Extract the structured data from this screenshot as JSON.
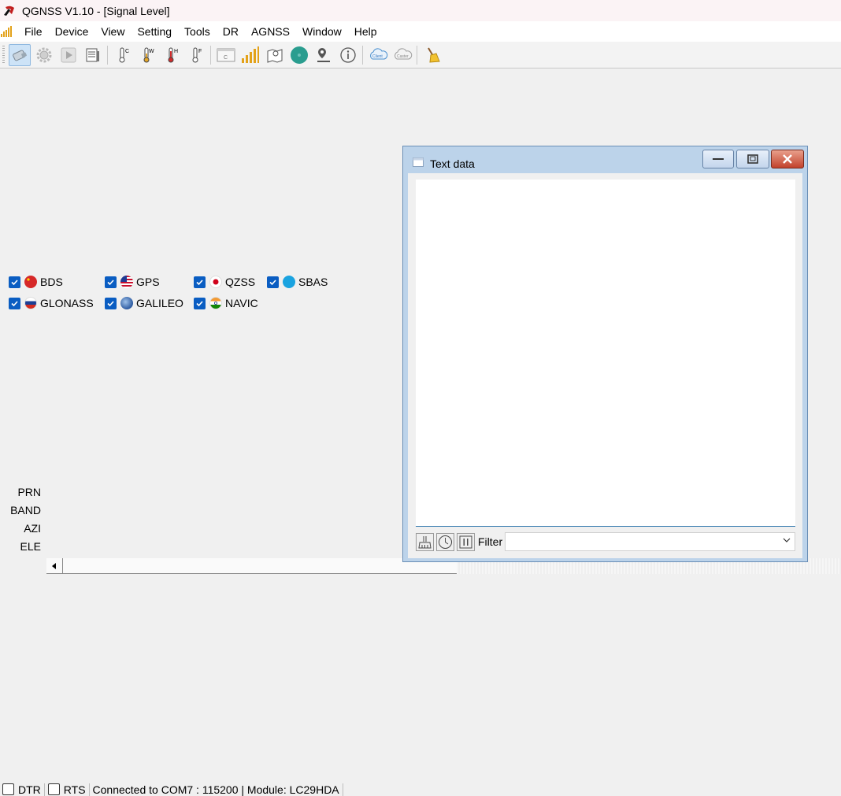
{
  "window": {
    "title": "QGNSS V1.10 - [Signal Level]"
  },
  "menu": [
    "File",
    "Device",
    "View",
    "Setting",
    "Tools",
    "DR",
    "AGNSS",
    "Window",
    "Help"
  ],
  "toolbar": {
    "icons": [
      "connect-icon",
      "settings-gear-icon",
      "play-icon",
      "log-file-icon",
      "thermometer-c-icon",
      "thermometer-w-icon",
      "thermometer-h-icon",
      "thermometer-f-icon",
      "console-c-icon",
      "signal-level-icon",
      "map-icon",
      "globe-icon",
      "location-pin-icon",
      "info-icon",
      "ntrip-client-icon",
      "ntrip-caster-icon",
      "broom-clean-icon"
    ],
    "client_label": "Client",
    "caster_label": "Caster",
    "console_label": "C"
  },
  "constellations": [
    {
      "name": "BDS",
      "checked": true
    },
    {
      "name": "GPS",
      "checked": true
    },
    {
      "name": "QZSS",
      "checked": true
    },
    {
      "name": "SBAS",
      "checked": true
    },
    {
      "name": "GLONASS",
      "checked": true
    },
    {
      "name": "GALILEO",
      "checked": true
    },
    {
      "name": "NAVIC",
      "checked": true
    }
  ],
  "axis_labels": {
    "prn": "PRN",
    "band": "BAND",
    "azi": "AZI",
    "ele": "ELE"
  },
  "text_window": {
    "title": "Text data",
    "filter_label": "Filter",
    "filter_value": ""
  },
  "status": {
    "dtr_label": "DTR",
    "dtr_checked": false,
    "rts_label": "RTS",
    "rts_checked": false,
    "connection": "Connected to COM7 : 115200 | Module: LC29HDA"
  }
}
